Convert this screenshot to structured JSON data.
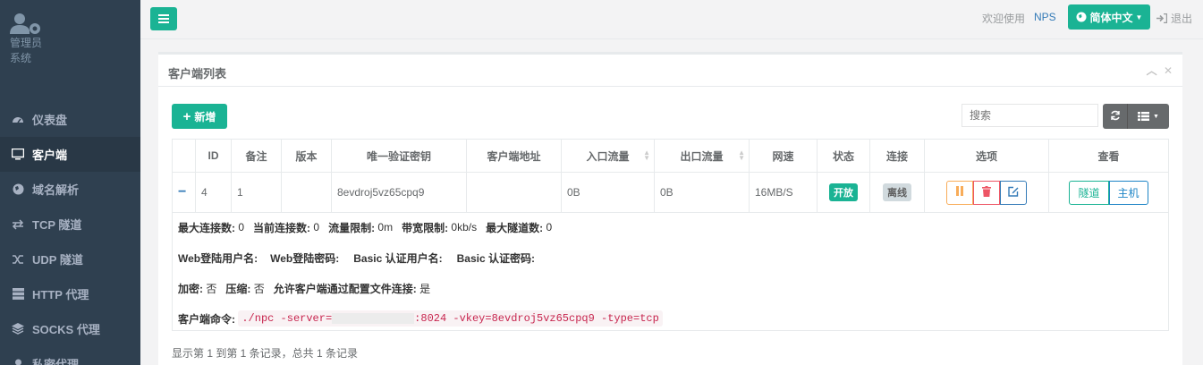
{
  "sidebar": {
    "user_name": "管理员",
    "user_role": "系统",
    "items": [
      {
        "label": "仪表盘",
        "icon": "dashboard-icon"
      },
      {
        "label": "客户端",
        "icon": "desktop-icon"
      },
      {
        "label": "域名解析",
        "icon": "globe-icon"
      },
      {
        "label": "TCP 隧道",
        "icon": "exchange-icon"
      },
      {
        "label": "UDP 隧道",
        "icon": "random-icon"
      },
      {
        "label": "HTTP 代理",
        "icon": "server-icon"
      },
      {
        "label": "SOCKS 代理",
        "icon": "layers-icon"
      },
      {
        "label": "私密代理",
        "icon": "user-secret-icon"
      }
    ]
  },
  "header": {
    "welcome": "欢迎使用",
    "brand": "NPS",
    "language": "简体中文",
    "logout": "退出"
  },
  "panel": {
    "title": "客户端列表",
    "add_label": "新增",
    "search_placeholder": "搜索"
  },
  "table": {
    "columns": [
      "",
      "ID",
      "备注",
      "版本",
      "唯一验证密钥",
      "客户端地址",
      "入口流量",
      "出口流量",
      "网速",
      "状态",
      "连接",
      "选项",
      "查看"
    ],
    "row": {
      "expand": "−",
      "id": "4",
      "remark": "1",
      "version": "",
      "vkey": "8evdroj5vz65cpq9",
      "address": "",
      "in_flow": "0B",
      "out_flow": "0B",
      "speed": "16MB/S",
      "status": "开放",
      "connect": "离线",
      "view_tunnel": "隧道",
      "view_host": "主机"
    }
  },
  "detail": {
    "max_conn_label": "最大连接数:",
    "max_conn": "0",
    "cur_conn_label": "当前连接数:",
    "cur_conn": "0",
    "flow_limit_label": "流量限制:",
    "flow_limit": "0m",
    "rate_limit_label": "带宽限制:",
    "rate_limit": "0kb/s",
    "max_tunnel_label": "最大隧道数:",
    "max_tunnel": "0",
    "web_user_label": "Web登陆用户名:",
    "web_pass_label": "Web登陆密码:",
    "basic_user_label": "Basic 认证用户名:",
    "basic_pass_label": "Basic 认证密码:",
    "crypt_label": "加密:",
    "crypt": "否",
    "compress_label": "压缩:",
    "compress": "否",
    "config_conn_label": "允许客户端通过配置文件连接:",
    "config_conn": "是",
    "cmd_label": "客户端命令:",
    "cmd_prefix": "./npc -server=",
    "cmd_suffix": ":8024 -vkey=8evdroj5vz65cpq9 -type=tcp"
  },
  "footer": {
    "summary": "显示第 1 到第 1 条记录，总共 1 条记录"
  },
  "colors": {
    "primary": "#1ab394",
    "sidebar_bg": "#2f4050",
    "danger": "#ed5565",
    "warning": "#f8ac59",
    "info": "#337ab7"
  }
}
